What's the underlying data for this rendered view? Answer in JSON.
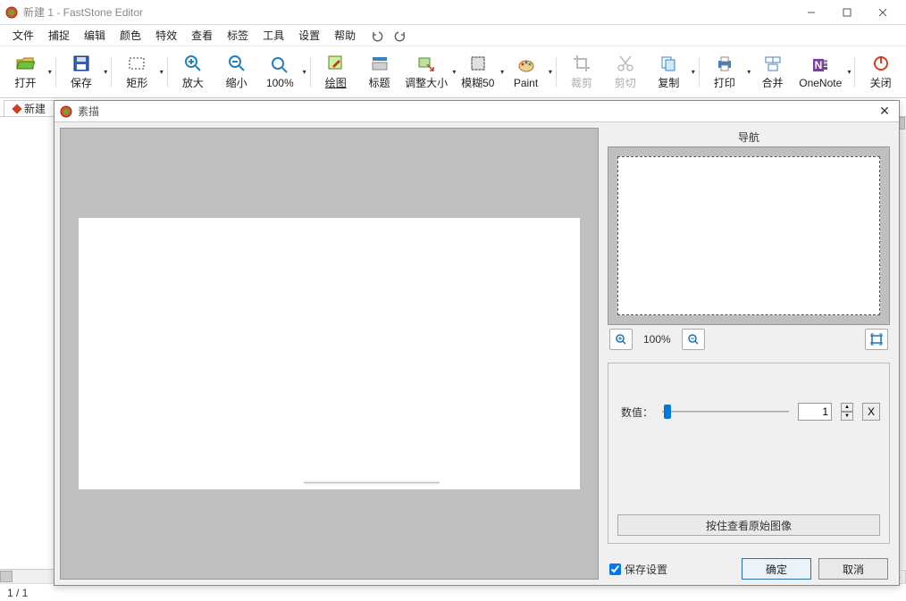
{
  "titlebar": {
    "title": "新建 1 - FastStone Editor"
  },
  "menu": {
    "items": [
      "文件",
      "捕捉",
      "编辑",
      "颜色",
      "特效",
      "查看",
      "标签",
      "工具",
      "设置",
      "帮助"
    ]
  },
  "toolbar": {
    "open": "打开",
    "save": "保存",
    "rect": "矩形",
    "zoomin": "放大",
    "zoomout": "缩小",
    "zoom100": "100%",
    "draw": "绘图",
    "title": "标题",
    "resize": "调整大小",
    "blur": "模糊50",
    "paint": "Paint",
    "crop": "裁剪",
    "cut": "剪切",
    "copy": "复制",
    "print": "打印",
    "merge": "合并",
    "onenote": "OneNote",
    "close": "关闭"
  },
  "doctab": {
    "label": "新建"
  },
  "status": {
    "page": "1 / 1"
  },
  "dialog": {
    "title": "素描",
    "nav_label": "导航",
    "zoom_label": "100%",
    "value_label": "数值：",
    "value": "1",
    "hold_btn": "按住查看原始图像",
    "save_settings": "保存设置",
    "ok": "确定",
    "cancel": "取消"
  }
}
